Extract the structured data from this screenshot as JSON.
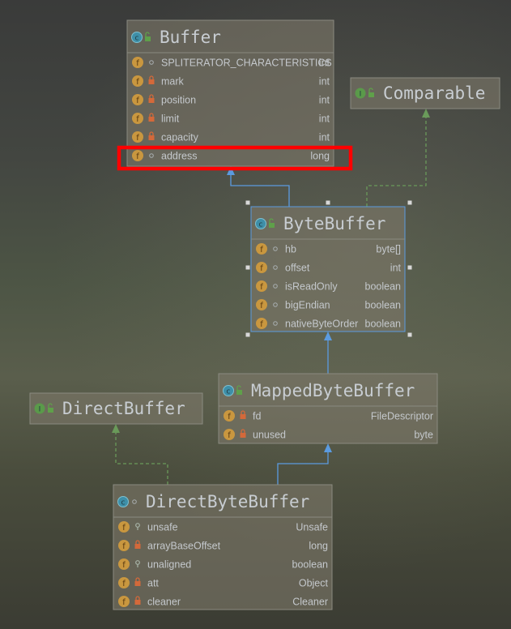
{
  "colors": {
    "inherit_edge": "#5b9be0",
    "implement_edge": "#6a9a5a",
    "highlight": "#ff0000",
    "field_icon": "#c9973f",
    "class_icon": "#3e8fa8"
  },
  "classes": [
    {
      "id": "buffer",
      "name": "Buffer",
      "kind": "class",
      "fields": [
        {
          "name": "SPLITERATOR_CHARACTERISTICS",
          "type": "int",
          "access": "package"
        },
        {
          "name": "mark",
          "type": "int",
          "access": "private"
        },
        {
          "name": "position",
          "type": "int",
          "access": "private"
        },
        {
          "name": "limit",
          "type": "int",
          "access": "private"
        },
        {
          "name": "capacity",
          "type": "int",
          "access": "private"
        },
        {
          "name": "address",
          "type": "long",
          "access": "package",
          "highlighted": true
        }
      ]
    },
    {
      "id": "comparable",
      "name": "Comparable",
      "kind": "interface",
      "fields": []
    },
    {
      "id": "bytebuffer",
      "name": "ByteBuffer",
      "kind": "class",
      "selected": true,
      "fields": [
        {
          "name": "hb",
          "type": "byte[]",
          "access": "package"
        },
        {
          "name": "offset",
          "type": "int",
          "access": "package"
        },
        {
          "name": "isReadOnly",
          "type": "boolean",
          "access": "package"
        },
        {
          "name": "bigEndian",
          "type": "boolean",
          "access": "package"
        },
        {
          "name": "nativeByteOrder",
          "type": "boolean",
          "access": "package"
        }
      ]
    },
    {
      "id": "mappedbytebuffer",
      "name": "MappedByteBuffer",
      "kind": "class",
      "fields": [
        {
          "name": "fd",
          "type": "FileDescriptor",
          "access": "private"
        },
        {
          "name": "unused",
          "type": "byte",
          "access": "private"
        }
      ]
    },
    {
      "id": "directbuffer",
      "name": "DirectBuffer",
      "kind": "interface",
      "fields": []
    },
    {
      "id": "directbytebuffer",
      "name": "DirectByteBuffer",
      "kind": "class",
      "fields": [
        {
          "name": "unsafe",
          "type": "Unsafe",
          "access": "protected"
        },
        {
          "name": "arrayBaseOffset",
          "type": "long",
          "access": "private"
        },
        {
          "name": "unaligned",
          "type": "boolean",
          "access": "protected"
        },
        {
          "name": "att",
          "type": "Object",
          "access": "private"
        },
        {
          "name": "cleaner",
          "type": "Cleaner",
          "access": "private"
        }
      ]
    }
  ],
  "edges": [
    {
      "from": "bytebuffer",
      "to": "buffer",
      "kind": "extends"
    },
    {
      "from": "bytebuffer",
      "to": "comparable",
      "kind": "implements"
    },
    {
      "from": "mappedbytebuffer",
      "to": "bytebuffer",
      "kind": "extends"
    },
    {
      "from": "directbytebuffer",
      "to": "mappedbytebuffer",
      "kind": "extends"
    },
    {
      "from": "directbytebuffer",
      "to": "directbuffer",
      "kind": "implements"
    }
  ]
}
